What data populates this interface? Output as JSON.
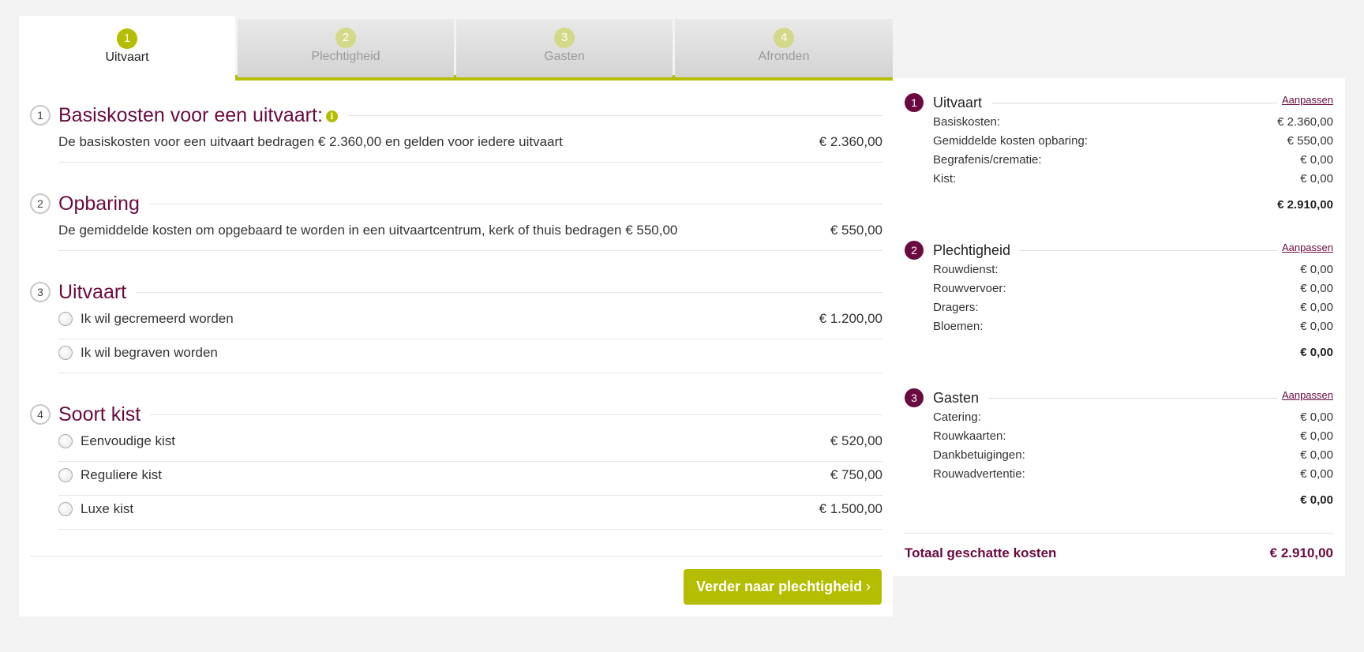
{
  "colors": {
    "accent": "#b4bd00",
    "brand": "#6a0a3f"
  },
  "tabs": [
    {
      "num": "1",
      "label": "Uitvaart"
    },
    {
      "num": "2",
      "label": "Plechtigheid"
    },
    {
      "num": "3",
      "label": "Gasten"
    },
    {
      "num": "4",
      "label": "Afronden"
    }
  ],
  "sections": [
    {
      "num": "1",
      "title": "Basiskosten voor een uitvaart:",
      "info_icon": "info-icon",
      "rows": [
        {
          "text": "De basiskosten voor een uitvaart bedragen € 2.360,00 en gelden voor iedere uitvaart",
          "amount": "€ 2.360,00"
        }
      ]
    },
    {
      "num": "2",
      "title": "Opbaring",
      "rows": [
        {
          "text": "De gemiddelde kosten om opgebaard te worden in een uitvaartcentrum, kerk of thuis bedragen € 550,00",
          "amount": "€ 550,00"
        }
      ]
    },
    {
      "num": "3",
      "title": "Uitvaart",
      "options": [
        {
          "label": "Ik wil gecremeerd worden",
          "amount": "€ 1.200,00"
        },
        {
          "label": "Ik wil begraven worden",
          "amount": ""
        }
      ]
    },
    {
      "num": "4",
      "title": "Soort kist",
      "options": [
        {
          "label": "Eenvoudige kist",
          "amount": "€ 520,00"
        },
        {
          "label": "Reguliere kist",
          "amount": "€ 750,00"
        },
        {
          "label": "Luxe kist",
          "amount": "€ 1.500,00"
        }
      ]
    }
  ],
  "next_button": {
    "label": "Verder naar plechtigheid",
    "icon": "chevron-right-icon"
  },
  "summary": {
    "blocks": [
      {
        "num": "1",
        "title": "Uitvaart",
        "link": "Aanpassen",
        "rows": [
          {
            "k": "Basiskosten:",
            "v": "€ 2.360,00"
          },
          {
            "k": "Gemiddelde kosten opbaring:",
            "v": "€ 550,00"
          },
          {
            "k": "Begrafenis/crematie:",
            "v": "€ 0,00"
          },
          {
            "k": "Kist:",
            "v": "€ 0,00"
          }
        ],
        "total": "€ 2.910,00"
      },
      {
        "num": "2",
        "title": "Plechtigheid",
        "link": "Aanpassen",
        "rows": [
          {
            "k": "Rouwdienst:",
            "v": "€ 0,00"
          },
          {
            "k": "Rouwvervoer:",
            "v": "€ 0,00"
          },
          {
            "k": "Dragers:",
            "v": "€ 0,00"
          },
          {
            "k": "Bloemen:",
            "v": "€ 0,00"
          }
        ],
        "total": "€ 0,00"
      },
      {
        "num": "3",
        "title": "Gasten",
        "link": "Aanpassen",
        "rows": [
          {
            "k": "Catering:",
            "v": "€ 0,00"
          },
          {
            "k": "Rouwkaarten:",
            "v": "€ 0,00"
          },
          {
            "k": "Dankbetuigingen:",
            "v": "€ 0,00"
          },
          {
            "k": "Rouwadvertentie:",
            "v": "€ 0,00"
          }
        ],
        "total": "€ 0,00"
      }
    ],
    "grand_label": "Totaal geschatte kosten",
    "grand_value": "€ 2.910,00"
  }
}
